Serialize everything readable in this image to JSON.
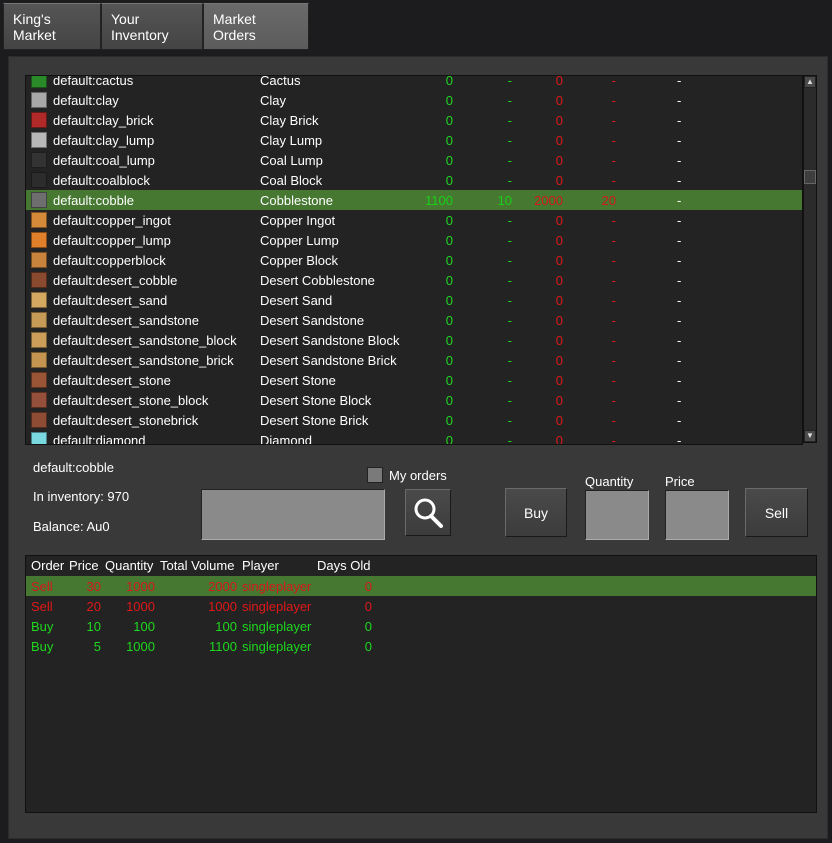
{
  "tabs": [
    "King's Market",
    "Your Inventory",
    "Market Orders"
  ],
  "items": [
    {
      "id": "default:cactus",
      "name": "Cactus",
      "buy_qty": "0",
      "buy_price": "-",
      "sell_qty": "0",
      "sell_price": "-",
      "days": "-",
      "icon": "cactus-icon",
      "color": "#2a8a2a"
    },
    {
      "id": "default:clay",
      "name": "Clay",
      "buy_qty": "0",
      "buy_price": "-",
      "sell_qty": "0",
      "sell_price": "-",
      "days": "-",
      "icon": "clay-icon",
      "color": "#a8a8a8"
    },
    {
      "id": "default:clay_brick",
      "name": "Clay Brick",
      "buy_qty": "0",
      "buy_price": "-",
      "sell_qty": "0",
      "sell_price": "-",
      "days": "-",
      "icon": "clay-brick-icon",
      "color": "#b02a2a"
    },
    {
      "id": "default:clay_lump",
      "name": "Clay Lump",
      "buy_qty": "0",
      "buy_price": "-",
      "sell_qty": "0",
      "sell_price": "-",
      "days": "-",
      "icon": "clay-lump-icon",
      "color": "#b8b8b8"
    },
    {
      "id": "default:coal_lump",
      "name": "Coal Lump",
      "buy_qty": "0",
      "buy_price": "-",
      "sell_qty": "0",
      "sell_price": "-",
      "days": "-",
      "icon": "coal-lump-icon",
      "color": "#333333"
    },
    {
      "id": "default:coalblock",
      "name": "Coal Block",
      "buy_qty": "0",
      "buy_price": "-",
      "sell_qty": "0",
      "sell_price": "-",
      "days": "-",
      "icon": "coal-block-icon",
      "color": "#2c2c2c"
    },
    {
      "id": "default:cobble",
      "name": "Cobblestone",
      "buy_qty": "1100",
      "buy_price": "10",
      "sell_qty": "2000",
      "sell_price": "20",
      "days": "-",
      "icon": "cobble-icon",
      "color": "#6e6e6e"
    },
    {
      "id": "default:copper_ingot",
      "name": "Copper Ingot",
      "buy_qty": "0",
      "buy_price": "-",
      "sell_qty": "0",
      "sell_price": "-",
      "days": "-",
      "icon": "copper-ingot-icon",
      "color": "#d58a3a"
    },
    {
      "id": "default:copper_lump",
      "name": "Copper Lump",
      "buy_qty": "0",
      "buy_price": "-",
      "sell_qty": "0",
      "sell_price": "-",
      "days": "-",
      "icon": "copper-lump-icon",
      "color": "#e0802a"
    },
    {
      "id": "default:copperblock",
      "name": "Copper Block",
      "buy_qty": "0",
      "buy_price": "-",
      "sell_qty": "0",
      "sell_price": "-",
      "days": "-",
      "icon": "copper-block-icon",
      "color": "#c8843c"
    },
    {
      "id": "default:desert_cobble",
      "name": "Desert Cobblestone",
      "buy_qty": "0",
      "buy_price": "-",
      "sell_qty": "0",
      "sell_price": "-",
      "days": "-",
      "icon": "desert-cobble-icon",
      "color": "#8a4a30"
    },
    {
      "id": "default:desert_sand",
      "name": "Desert Sand",
      "buy_qty": "0",
      "buy_price": "-",
      "sell_qty": "0",
      "sell_price": "-",
      "days": "-",
      "icon": "desert-sand-icon",
      "color": "#d4a860"
    },
    {
      "id": "default:desert_sandstone",
      "name": "Desert Sandstone",
      "buy_qty": "0",
      "buy_price": "-",
      "sell_qty": "0",
      "sell_price": "-",
      "days": "-",
      "icon": "desert-sandstone-icon",
      "color": "#c89a58"
    },
    {
      "id": "default:desert_sandstone_block",
      "name": "Desert Sandstone Block",
      "buy_qty": "0",
      "buy_price": "-",
      "sell_qty": "0",
      "sell_price": "-",
      "days": "-",
      "icon": "desert-sandstone-block-icon",
      "color": "#cc9e5a"
    },
    {
      "id": "default:desert_sandstone_brick",
      "name": "Desert Sandstone Brick",
      "buy_qty": "0",
      "buy_price": "-",
      "sell_qty": "0",
      "sell_price": "-",
      "days": "-",
      "icon": "desert-sandstone-brick-icon",
      "color": "#c49450"
    },
    {
      "id": "default:desert_stone",
      "name": "Desert Stone",
      "buy_qty": "0",
      "buy_price": "-",
      "sell_qty": "0",
      "sell_price": "-",
      "days": "-",
      "icon": "desert-stone-icon",
      "color": "#9a5436"
    },
    {
      "id": "default:desert_stone_block",
      "name": "Desert Stone Block",
      "buy_qty": "0",
      "buy_price": "-",
      "sell_qty": "0",
      "sell_price": "-",
      "days": "-",
      "icon": "desert-stone-block-icon",
      "color": "#94503a"
    },
    {
      "id": "default:desert_stonebrick",
      "name": "Desert Stone Brick",
      "buy_qty": "0",
      "buy_price": "-",
      "sell_qty": "0",
      "sell_price": "-",
      "days": "-",
      "icon": "desert-stonebrick-icon",
      "color": "#8e4c34"
    },
    {
      "id": "default:diamond",
      "name": "Diamond",
      "buy_qty": "0",
      "buy_price": "-",
      "sell_qty": "0",
      "sell_price": "-",
      "days": "-",
      "icon": "diamond-icon",
      "color": "#7ad8e0"
    }
  ],
  "selected_item": {
    "id": "default:cobble",
    "inventory": "In inventory: 970",
    "balance": "Balance: Au0"
  },
  "my_orders_label": "My orders",
  "quantity_label": "Quantity",
  "price_label": "Price",
  "buy_label": "Buy",
  "sell_label": "Sell",
  "search_value": "",
  "quantity_value": "",
  "price_value": "",
  "orders_header": [
    "Order",
    "Price",
    "Quantity",
    "Total Volume",
    "Player",
    "Days Old"
  ],
  "orders": [
    {
      "order": "Sell",
      "price": "30",
      "quantity": "1000",
      "volume": "2000",
      "player": "singleplayer",
      "days": "0"
    },
    {
      "order": "Sell",
      "price": "20",
      "quantity": "1000",
      "volume": "1000",
      "player": "singleplayer",
      "days": "0"
    },
    {
      "order": "Buy",
      "price": "10",
      "quantity": "100",
      "volume": "100",
      "player": "singleplayer",
      "days": "0"
    },
    {
      "order": "Buy",
      "price": "5",
      "quantity": "1000",
      "volume": "1100",
      "player": "singleplayer",
      "days": "0"
    }
  ]
}
